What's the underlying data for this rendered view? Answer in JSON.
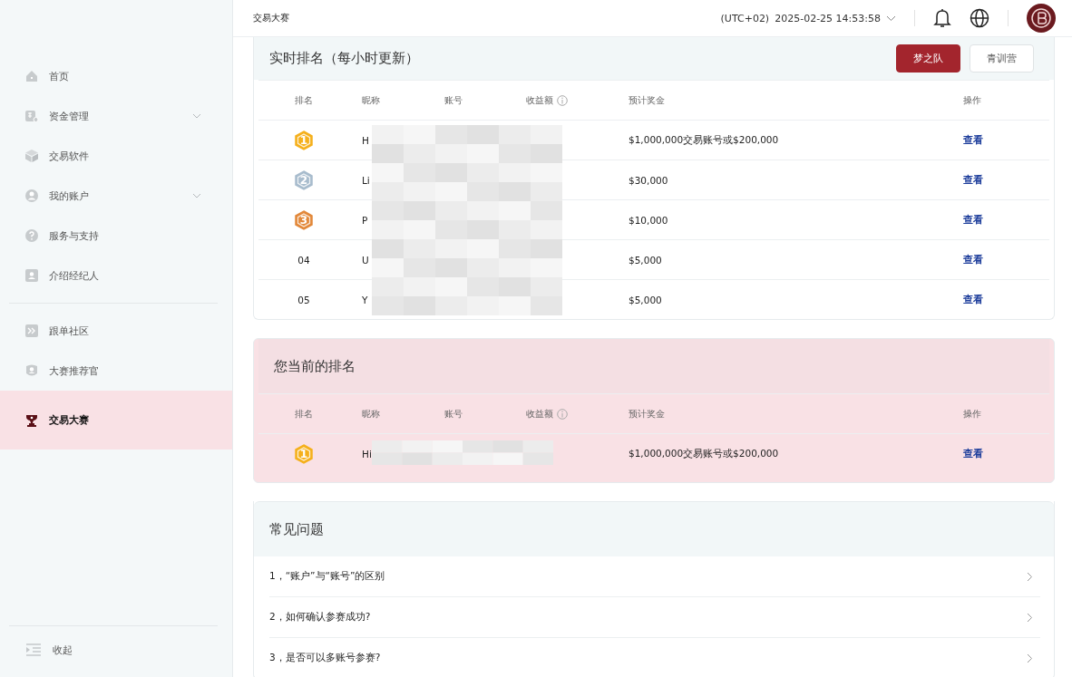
{
  "page_title": "交易大赛",
  "timezone": "(UTC+02)",
  "datetime": "2025-02-25 14:53:58",
  "sidebar": {
    "groups": [
      [
        {
          "label": "首页",
          "expandable": false,
          "selected": false
        },
        {
          "label": "资金管理",
          "expandable": true,
          "selected": false
        },
        {
          "label": "交易软件",
          "expandable": false,
          "selected": false
        },
        {
          "label": "我的账户",
          "expandable": true,
          "selected": false
        },
        {
          "label": "服务与支持",
          "expandable": false,
          "selected": false
        },
        {
          "label": "介绍经纪人",
          "expandable": false,
          "selected": false
        }
      ],
      [
        {
          "label": "跟单社区",
          "expandable": false,
          "selected": false
        },
        {
          "label": "大赛推荐官",
          "expandable": false,
          "selected": false
        },
        {
          "label": "交易大赛",
          "expandable": false,
          "selected": true
        }
      ]
    ],
    "collapse": "收起"
  },
  "live_ranking": {
    "title": "实时排名（每小时更新）",
    "tabs": [
      {
        "label": "梦之队",
        "selected": true
      },
      {
        "label": "青训营",
        "selected": false
      }
    ],
    "columns": [
      {
        "label": "排名",
        "info": false
      },
      {
        "label": "昵称",
        "info": false
      },
      {
        "label": "账号",
        "info": false
      },
      {
        "label": "收益额",
        "info": true
      },
      {
        "label": "预计奖金",
        "info": false
      },
      {
        "label": "操作",
        "info": false
      }
    ],
    "rows": [
      {
        "rank": "1",
        "kind": "medal",
        "color": "#f5b01c",
        "nickname": "H",
        "prize": "$1,000,000交易账号或$200,000",
        "action": "查看"
      },
      {
        "rank": "2",
        "kind": "medal",
        "color": "#a8bccd",
        "nickname": "Li",
        "prize": "$30,000",
        "action": "查看"
      },
      {
        "rank": "3",
        "kind": "medal",
        "color": "#e2883a",
        "nickname": "P",
        "prize": "$10,000",
        "action": "查看"
      },
      {
        "rank": "04",
        "kind": "plain",
        "nickname": "U",
        "prize": "$5,000",
        "action": "查看"
      },
      {
        "rank": "05",
        "kind": "plain",
        "nickname": "Y",
        "prize": "$5,000",
        "action": "查看"
      }
    ]
  },
  "my_ranking": {
    "title": "您当前的排名",
    "columns": [
      {
        "label": "排名",
        "info": false
      },
      {
        "label": "昵称",
        "info": false
      },
      {
        "label": "账号",
        "info": false
      },
      {
        "label": "收益额",
        "info": true
      },
      {
        "label": "预计奖金",
        "info": false
      },
      {
        "label": "操作",
        "info": false
      }
    ],
    "rows": [
      {
        "rank": "1",
        "kind": "medal",
        "color": "#f5b01c",
        "nickname": "Hi",
        "prize": "$1,000,000交易账号或$200,000",
        "action": "查看"
      }
    ]
  },
  "faq": {
    "title": "常见问题",
    "items": [
      "1，“账户”与“账号”的区别",
      "2，如何确认参赛成功?",
      "3，是否可以多账号参赛?"
    ]
  }
}
